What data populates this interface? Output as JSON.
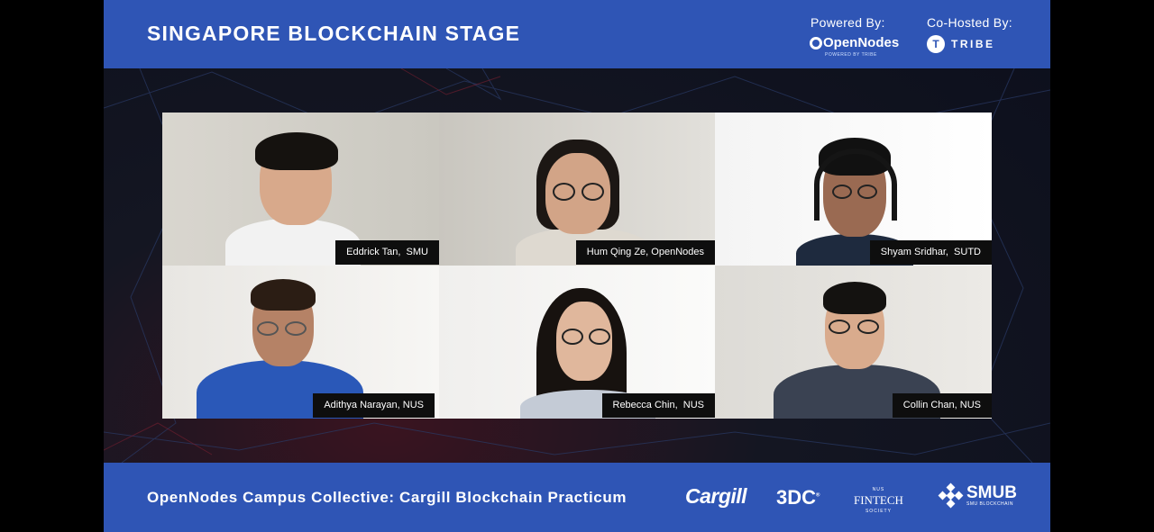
{
  "header": {
    "title": "SINGAPORE BLOCKCHAIN STAGE",
    "powered_by_label": "Powered By:",
    "powered_by_logo": "OpenNodes",
    "powered_by_sub": "POWERED BY TRIBE",
    "cohosted_by_label": "Co-Hosted By:",
    "cohost_logo": "TRIBE"
  },
  "participants": [
    {
      "name": "Eddrick Tan,  SMU"
    },
    {
      "name": "Hum Qing Ze, OpenNodes"
    },
    {
      "name": "Shyam Sridhar,  SUTD"
    },
    {
      "name": "Adithya Narayan, NUS"
    },
    {
      "name": "Rebecca Chin,  NUS"
    },
    {
      "name": "Collin Chan, NUS"
    }
  ],
  "footer": {
    "event_title": "OpenNodes Campus Collective: Cargill Blockchain Practicum",
    "sponsors": {
      "cargill": "Cargill",
      "tdc": "3DC",
      "tdc_mark": "®",
      "fintech_top": "NUS",
      "fintech_main": "FINTECH",
      "fintech_sub": "SOCIETY",
      "smub": "SMUB",
      "smub_sub": "SMU BLOCKCHAIN"
    }
  },
  "colors": {
    "banner": "#2f55b5",
    "background": "#0c0f1c",
    "name_tag": "#0e0e0e"
  }
}
